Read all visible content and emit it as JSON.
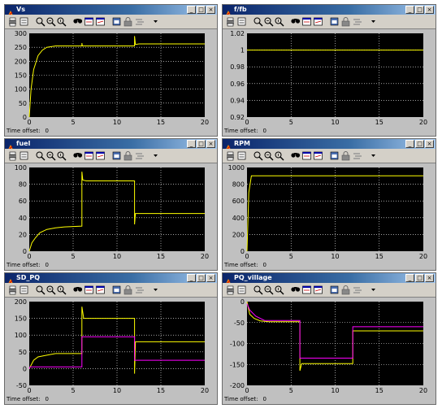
{
  "window_buttons": {
    "minimize": "_",
    "maximize": "□",
    "close": "×"
  },
  "toolbar_icons": [
    "print-icon",
    "params-icon",
    "zoom-icon",
    "zoom-x-icon",
    "zoom-y-icon",
    "autoscale-icon",
    "save-axes-icon",
    "restore-axes-icon",
    "floating-icon",
    "lock-icon",
    "selector-icon",
    "dropdown-icon"
  ],
  "scopes": [
    {
      "title": "Vs",
      "time_offset_label": "Time offset:",
      "time_offset_value": "0"
    },
    {
      "title": "f/fb",
      "time_offset_label": "Time offset:",
      "time_offset_value": "0"
    },
    {
      "title": "fuel",
      "time_offset_label": "Time offset:",
      "time_offset_value": "0"
    },
    {
      "title": "RPM",
      "time_offset_label": "Time offset:",
      "time_offset_value": "0"
    },
    {
      "title": "SD_PQ",
      "time_offset_label": "Time offset:",
      "time_offset_value": "0"
    },
    {
      "title": "PQ_village",
      "time_offset_label": "Time offset:",
      "time_offset_value": "0"
    }
  ],
  "colors": {
    "plot_bg": "#000000",
    "grid": "#ffffff",
    "yellow": "#ffff00",
    "magenta": "#ff00ff",
    "window": "#c0c0c0"
  },
  "chart_data": [
    {
      "type": "line",
      "title": "",
      "xlim": [
        0,
        20
      ],
      "ylim": [
        0,
        300
      ],
      "xticks": [
        "0",
        "5",
        "10",
        "15",
        "20"
      ],
      "yticks": [
        "0",
        "50",
        "100",
        "150",
        "200",
        "250",
        "300"
      ],
      "series": [
        {
          "color": "#ffff00",
          "x": [
            0,
            0.2,
            0.5,
            1,
            1.5,
            2,
            3,
            5,
            6,
            6,
            6.05,
            12,
            12,
            12.1,
            12.5,
            20
          ],
          "y": [
            0,
            100,
            170,
            220,
            240,
            250,
            255,
            255,
            255,
            265,
            255,
            255,
            290,
            260,
            262,
            262
          ]
        }
      ]
    },
    {
      "type": "line",
      "title": "",
      "xlim": [
        0,
        20
      ],
      "ylim": [
        0.92,
        1.02
      ],
      "xticks": [
        "0",
        "5",
        "10",
        "15",
        "20"
      ],
      "yticks": [
        "0.92",
        "0.94",
        "0.96",
        "0.98",
        "1",
        "1.02"
      ],
      "series": [
        {
          "color": "#ffff00",
          "x": [
            0,
            0.3,
            20
          ],
          "y": [
            1.0,
            1.0,
            1.0
          ]
        }
      ]
    },
    {
      "type": "line",
      "title": "",
      "xlim": [
        0,
        20
      ],
      "ylim": [
        0,
        100
      ],
      "xticks": [
        "0",
        "5",
        "10",
        "15",
        "20"
      ],
      "yticks": [
        "0",
        "20",
        "40",
        "60",
        "80",
        "100"
      ],
      "series": [
        {
          "color": "#ffff00",
          "x": [
            0,
            0.3,
            0.7,
            1.2,
            2,
            3,
            4,
            6,
            6,
            6.1,
            6.5,
            12,
            12,
            12.1,
            20
          ],
          "y": [
            0,
            10,
            16,
            22,
            26,
            28,
            29,
            30,
            95,
            85,
            84,
            84,
            32,
            45,
            45
          ]
        }
      ]
    },
    {
      "type": "line",
      "title": "",
      "xlim": [
        0,
        20
      ],
      "ylim": [
        0,
        1000
      ],
      "xticks": [
        "0",
        "5",
        "10",
        "15",
        "20"
      ],
      "yticks": [
        "0",
        "200",
        "400",
        "600",
        "800",
        "1000"
      ],
      "series": [
        {
          "color": "#ffff00",
          "x": [
            0,
            0.2,
            0.5,
            20
          ],
          "y": [
            0,
            700,
            900,
            900
          ]
        }
      ]
    },
    {
      "type": "line",
      "title": "",
      "xlim": [
        0,
        20
      ],
      "ylim": [
        -50,
        200
      ],
      "xticks": [
        "0",
        "5",
        "10",
        "15",
        "20"
      ],
      "yticks": [
        "-50",
        "0",
        "50",
        "100",
        "150",
        "200"
      ],
      "series": [
        {
          "color": "#ffff00",
          "x": [
            0,
            0.5,
            1,
            2,
            3,
            4,
            6,
            6,
            6.2,
            12,
            12,
            12.1,
            20
          ],
          "y": [
            0,
            25,
            35,
            40,
            45,
            45,
            45,
            185,
            150,
            150,
            -15,
            80,
            80
          ]
        },
        {
          "color": "#ff00ff",
          "x": [
            0,
            0.1,
            6,
            6,
            12,
            12,
            20
          ],
          "y": [
            0,
            5,
            5,
            95,
            95,
            25,
            25
          ]
        }
      ]
    },
    {
      "type": "line",
      "title": "",
      "xlim": [
        0,
        20
      ],
      "ylim": [
        -200,
        0
      ],
      "xticks": [
        "0",
        "5",
        "10",
        "15",
        "20"
      ],
      "yticks": [
        "-200",
        "-150",
        "-100",
        "-50",
        "0"
      ],
      "series": [
        {
          "color": "#ffff00",
          "x": [
            0,
            0.3,
            0.8,
            1.5,
            2.5,
            6,
            6,
            6.2,
            12,
            12,
            20
          ],
          "y": [
            0,
            -30,
            -40,
            -46,
            -48,
            -48,
            -165,
            -148,
            -148,
            -70,
            -70
          ]
        },
        {
          "color": "#ff00ff",
          "x": [
            0,
            0.3,
            1,
            2,
            6,
            6,
            12,
            12,
            20
          ],
          "y": [
            -5,
            -20,
            -35,
            -45,
            -45,
            -135,
            -135,
            -60,
            -60
          ]
        }
      ]
    }
  ]
}
